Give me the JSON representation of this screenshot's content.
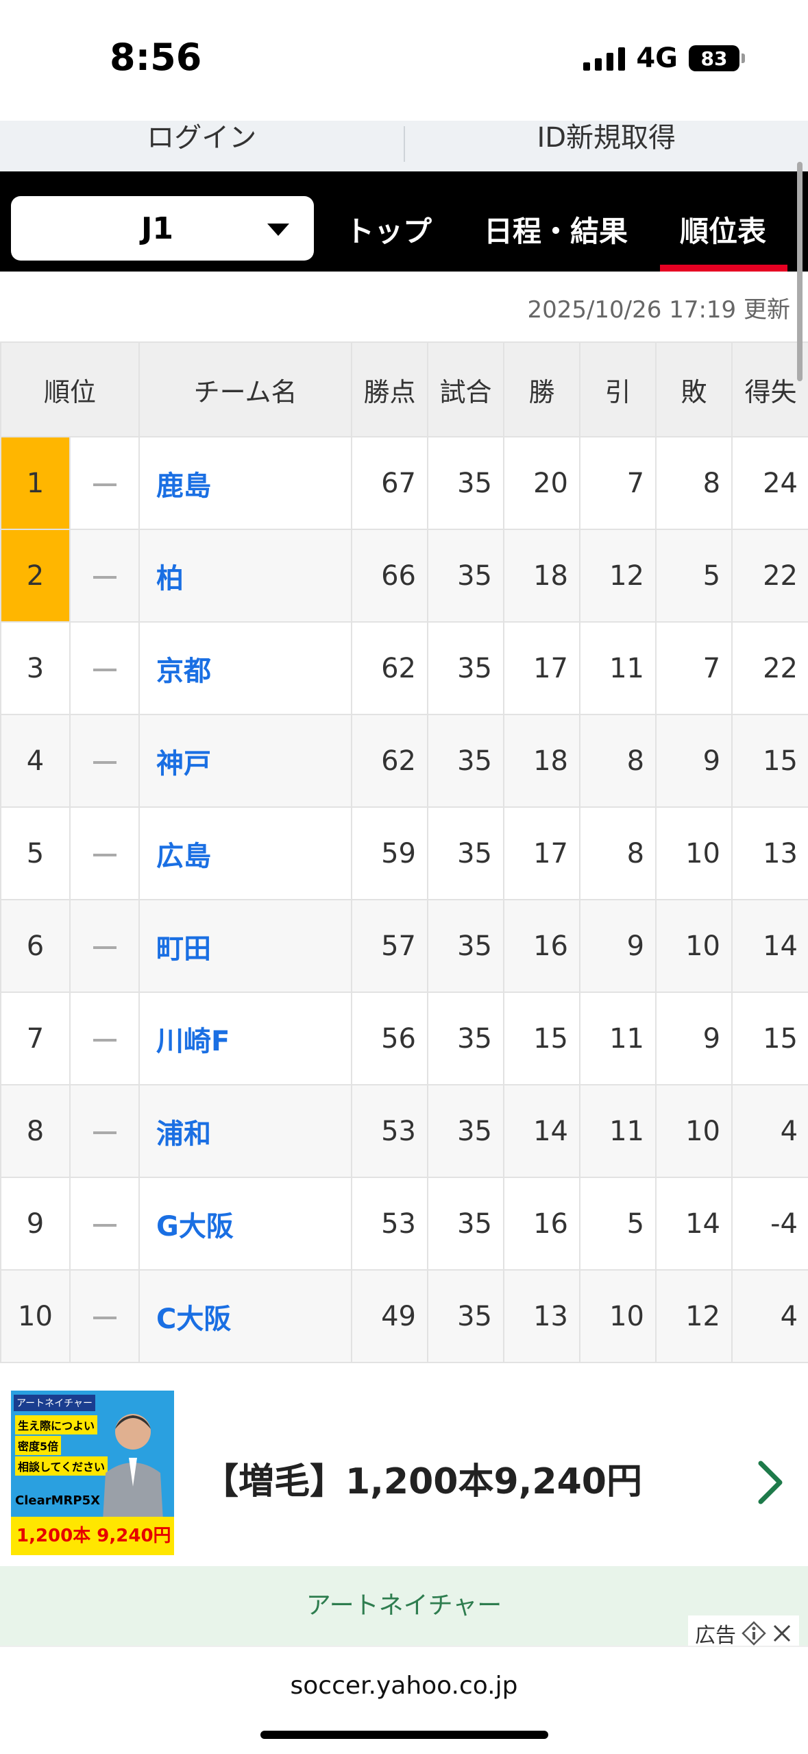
{
  "status_bar": {
    "time": "8:56",
    "network": "4G",
    "battery": "83"
  },
  "account": {
    "login": "ログイン",
    "register": "ID新規取得"
  },
  "nav": {
    "league": "J1",
    "tabs": [
      {
        "label": "トップ"
      },
      {
        "label": "日程・結果"
      },
      {
        "label": "順位表"
      }
    ]
  },
  "updated": "2025/10/26 17:19 更新",
  "table": {
    "headers": [
      "順位",
      "チーム名",
      "勝点",
      "試合",
      "勝",
      "引",
      "敗",
      "得失"
    ],
    "rows": [
      {
        "rank": "1",
        "team": "鹿島",
        "pts": "67",
        "played": "35",
        "w": "20",
        "d": "7",
        "l": "8",
        "gd": "24"
      },
      {
        "rank": "2",
        "team": "柏",
        "pts": "66",
        "played": "35",
        "w": "18",
        "d": "12",
        "l": "5",
        "gd": "22"
      },
      {
        "rank": "3",
        "team": "京都",
        "pts": "62",
        "played": "35",
        "w": "17",
        "d": "11",
        "l": "7",
        "gd": "22"
      },
      {
        "rank": "4",
        "team": "神戸",
        "pts": "62",
        "played": "35",
        "w": "18",
        "d": "8",
        "l": "9",
        "gd": "15"
      },
      {
        "rank": "5",
        "team": "広島",
        "pts": "59",
        "played": "35",
        "w": "17",
        "d": "8",
        "l": "10",
        "gd": "13"
      },
      {
        "rank": "6",
        "team": "町田",
        "pts": "57",
        "played": "35",
        "w": "16",
        "d": "9",
        "l": "10",
        "gd": "14"
      },
      {
        "rank": "7",
        "team": "川崎F",
        "pts": "56",
        "played": "35",
        "w": "15",
        "d": "11",
        "l": "9",
        "gd": "15"
      },
      {
        "rank": "8",
        "team": "浦和",
        "pts": "53",
        "played": "35",
        "w": "14",
        "d": "11",
        "l": "10",
        "gd": "4"
      },
      {
        "rank": "9",
        "team": "G大阪",
        "pts": "53",
        "played": "35",
        "w": "16",
        "d": "5",
        "l": "14",
        "gd": "-4"
      },
      {
        "rank": "10",
        "team": "C大阪",
        "pts": "49",
        "played": "35",
        "w": "13",
        "d": "10",
        "l": "12",
        "gd": "4"
      }
    ]
  },
  "ad": {
    "image_tag": "アートネイチャー",
    "image_line1": "生え際につよい",
    "image_line2": "密度5倍",
    "image_line3": "相談してください",
    "image_brand": "ClearMRP5X",
    "image_price": "1,200本 9,240円",
    "title": "【増毛】1,200本9,240円",
    "sponsor": "アートネイチャー",
    "label": "広告"
  },
  "browser": {
    "url": "soccer.yahoo.co.jp"
  },
  "colors": {
    "accent_red": "#e60022",
    "highlight_rank": "#ffb600",
    "team_link": "#1a6fe3"
  }
}
